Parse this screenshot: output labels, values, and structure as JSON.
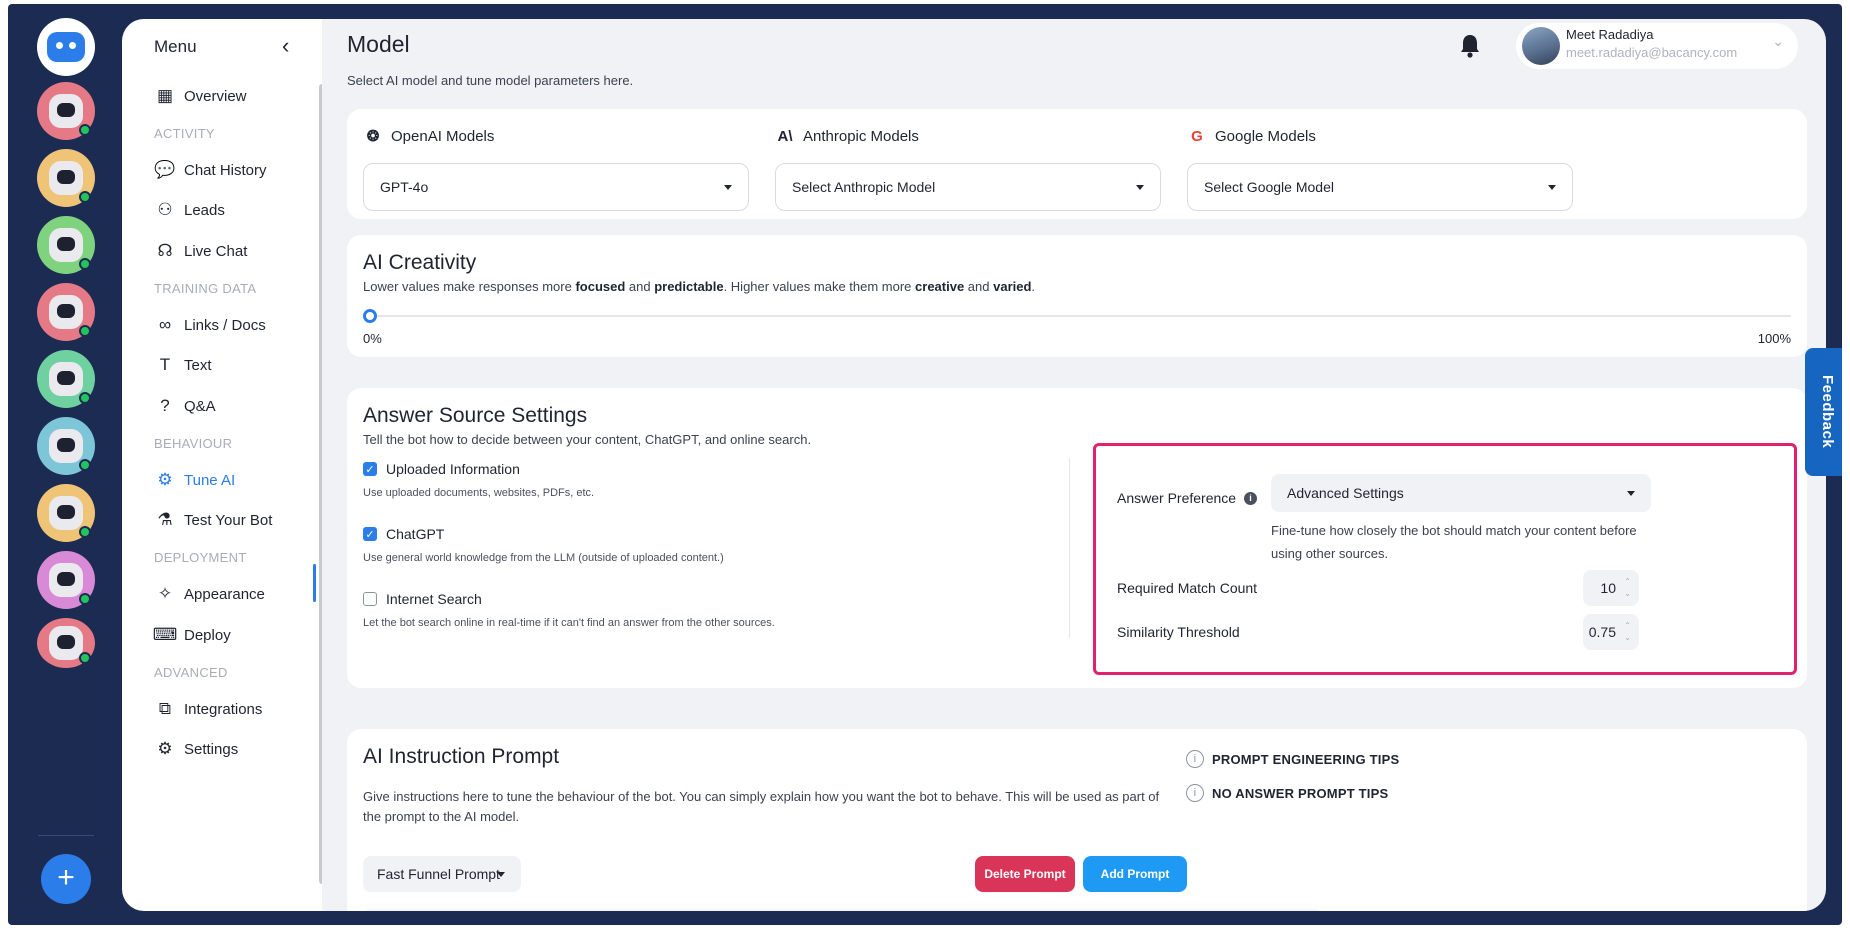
{
  "sidebar": {
    "title": "Menu",
    "items": {
      "overview": "Overview",
      "chat_history": "Chat History",
      "leads": "Leads",
      "live_chat": "Live Chat",
      "links_docs": "Links / Docs",
      "text": "Text",
      "qa": "Q&A",
      "tune_ai": "Tune AI",
      "test_your_bot": "Test Your Bot",
      "appearance": "Appearance",
      "deploy": "Deploy",
      "integrations": "Integrations",
      "settings": "Settings"
    },
    "sections": {
      "activity": "ACTIVITY",
      "training_data": "TRAINING DATA",
      "behaviour": "BEHAVIOUR",
      "deployment": "DEPLOYMENT",
      "advanced": "ADVANCED"
    },
    "active_item": "Tune AI"
  },
  "bot_rail": {
    "bot_colors": [
      "#e57a86",
      "#f0c477",
      "#7fd37f",
      "#e57a86",
      "#6fd0a0",
      "#7cc6d8",
      "#f0c477",
      "#d98ad6",
      "#e57a86"
    ],
    "add_label": "+"
  },
  "header": {
    "title": "Model",
    "subtitle": "Select AI model and tune model parameters here.",
    "user": {
      "name": "Meet Radadiya",
      "email": "meet.radadiya@bacancy.com"
    }
  },
  "models": {
    "openai": {
      "label": "OpenAI Models",
      "value": "GPT-4o",
      "icon": "openai-icon"
    },
    "anthropic": {
      "label": "Anthropic Models",
      "value": "Select Anthropic Model",
      "icon": "anthropic-icon"
    },
    "google": {
      "label": "Google Models",
      "value": "Select Google Model",
      "icon": "google-icon"
    }
  },
  "creativity": {
    "title": "AI Creativity",
    "desc_1": "Lower values make responses more ",
    "desc_focused": "focused",
    "desc_2": " and ",
    "desc_predictable": "predictable",
    "desc_3": ". Higher values make them more ",
    "desc_creative": "creative",
    "desc_4": " and ",
    "desc_varied": "varied",
    "desc_5": ".",
    "min_label": "0%",
    "max_label": "100%",
    "value_percent": 0
  },
  "answer_source": {
    "title": "Answer Source Settings",
    "subtitle": "Tell the bot how to decide between your content, ChatGPT, and online search.",
    "options": [
      {
        "label": "Uploaded Information",
        "desc": "Use uploaded documents, websites, PDFs, etc.",
        "checked": true
      },
      {
        "label": "ChatGPT",
        "desc": "Use general world knowledge from the LLM (outside of uploaded content.)",
        "checked": true
      },
      {
        "label": "Internet Search",
        "desc": "Let the bot search online in real-time if it can't find an answer from the other sources.",
        "checked": false
      }
    ],
    "preference_label": "Answer Preference",
    "preference_value": "Advanced Settings",
    "preference_help": "Fine-tune how closely the bot should match your content before using other sources.",
    "match_count_label": "Required Match Count",
    "match_count_value": "10",
    "similarity_label": "Similarity Threshold",
    "similarity_value": "0.75",
    "highlight_color": "#e0226e"
  },
  "instruction": {
    "title": "AI Instruction Prompt",
    "desc": "Give instructions here to tune the behaviour of the bot. You can simply explain how you want the bot to behave. This will be used as part of the prompt to the AI model.",
    "tips": [
      "PROMPT ENGINEERING TIPS",
      "NO ANSWER PROMPT TIPS"
    ],
    "prompt_select": "Fast Funnel Prompt",
    "delete_label": "Delete Prompt",
    "add_label": "Add Prompt"
  },
  "feedback": {
    "label": "Feedback"
  },
  "colors": {
    "accent": "#2b7de9",
    "rail": "#1c2b52",
    "danger": "#d93558",
    "add": "#1f9af4"
  }
}
